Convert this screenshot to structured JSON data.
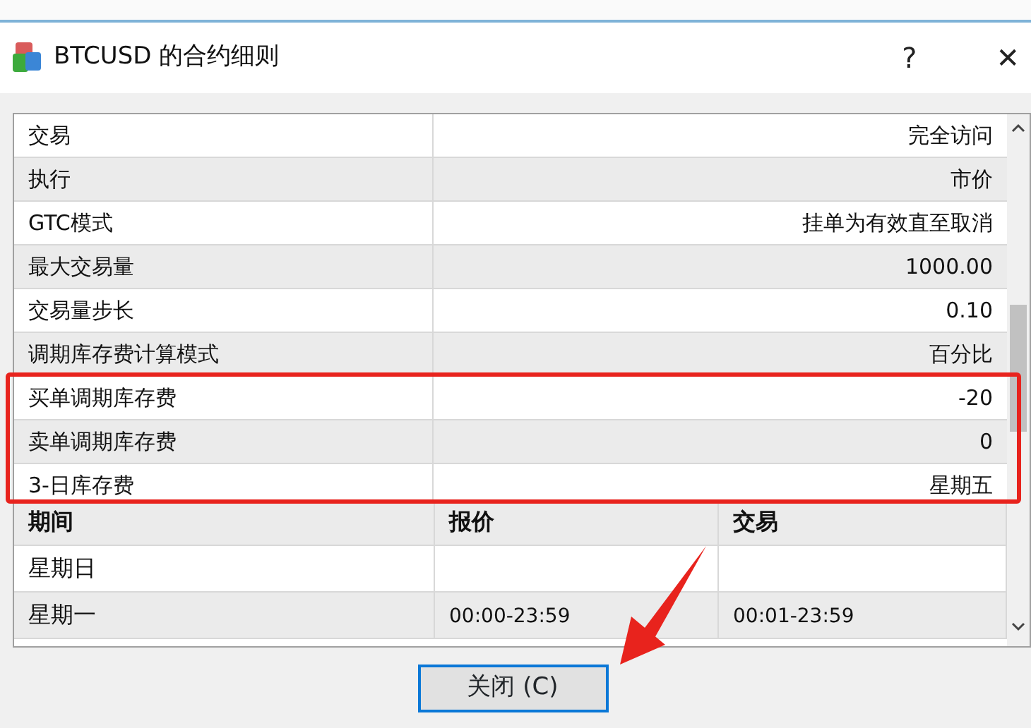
{
  "dialog": {
    "title": "BTCUSD 的合约细则",
    "help": "?",
    "close": "✕"
  },
  "details": [
    {
      "name": "交易",
      "value": "完全访问"
    },
    {
      "name": "执行",
      "value": "市价"
    },
    {
      "name": "GTC模式",
      "value": "挂单为有效直至取消"
    },
    {
      "name": "最大交易量",
      "value": "1000.00"
    },
    {
      "name": "交易量步长",
      "value": "0.10"
    },
    {
      "name": "调期库存费计算模式",
      "value": "百分比"
    }
  ],
  "highlighted_details": [
    {
      "name": "买单调期库存费",
      "value": "-20"
    },
    {
      "name": "卖单调期库存费",
      "value": "0"
    },
    {
      "name": "3-日库存费",
      "value": "星期五"
    }
  ],
  "sessions": {
    "columns": [
      "期间",
      "报价",
      "交易"
    ],
    "rows": [
      [
        "星期日",
        "",
        ""
      ],
      [
        "星期一",
        "00:00-23:59",
        "00:01-23:59"
      ]
    ]
  },
  "annotation_arrow": true,
  "close_button": "关闭 (C)"
}
